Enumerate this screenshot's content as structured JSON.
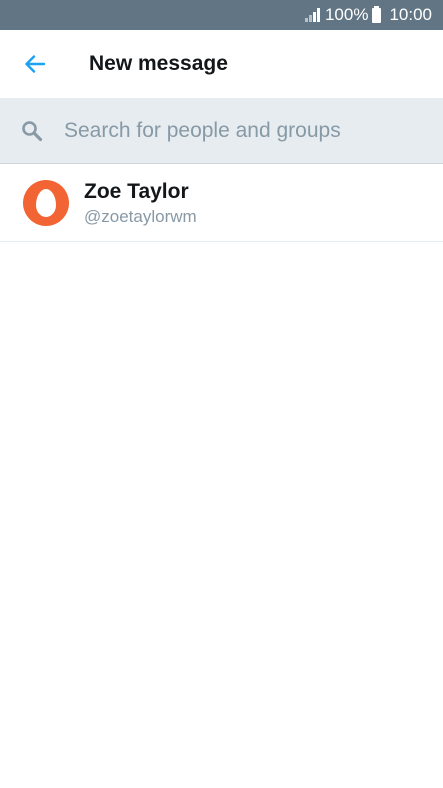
{
  "status_bar": {
    "battery_percent": "100%",
    "time": "10:00",
    "icons": [
      "signal-icon",
      "battery-icon"
    ]
  },
  "toolbar": {
    "back_icon": "arrow-left-icon",
    "title": "New message"
  },
  "search": {
    "icon": "search-icon",
    "placeholder": "Search for people and groups",
    "value": ""
  },
  "results": [
    {
      "name": "Zoe Taylor",
      "handle": "@zoetaylorwm",
      "avatar_icon": "default-egg-avatar-icon",
      "avatar_color": "#f26433"
    }
  ],
  "colors": {
    "status_bar": "#627584",
    "accent": "#1da1f2",
    "search_bg": "#e6ecf0",
    "text_primary": "#14171a",
    "text_secondary": "#8899a6"
  }
}
